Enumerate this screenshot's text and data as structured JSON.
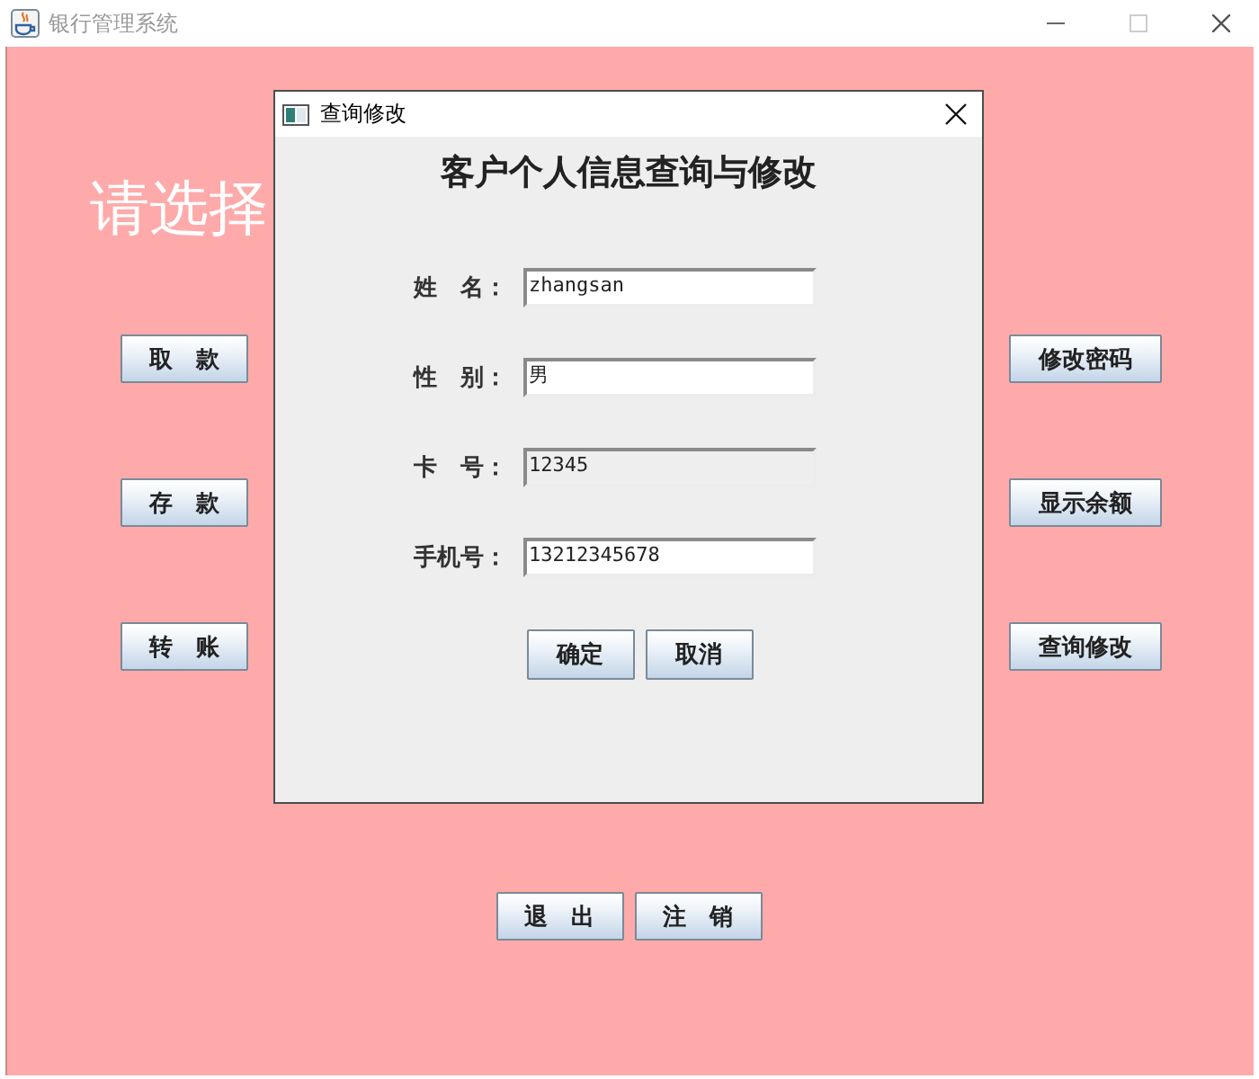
{
  "window": {
    "title": "银行管理系统"
  },
  "main": {
    "prompt": "请选择",
    "left_buttons": [
      "取　款",
      "存　款",
      "转　账"
    ],
    "right_buttons": [
      "修改密码",
      "显示余额",
      "查询修改"
    ],
    "bottom_buttons": [
      "退　出",
      "注　销"
    ]
  },
  "dialog": {
    "title": "查询修改",
    "heading": "客户个人信息查询与修改",
    "fields": [
      {
        "label": "姓　名：",
        "value": "zhangsan",
        "editable": true
      },
      {
        "label": "性　别：",
        "value": "男",
        "editable": true
      },
      {
        "label": "卡　号：",
        "value": "12345",
        "editable": false
      },
      {
        "label": "手机号：",
        "value": "13212345678",
        "editable": true
      }
    ],
    "buttons": [
      "确定",
      "取消"
    ]
  }
}
